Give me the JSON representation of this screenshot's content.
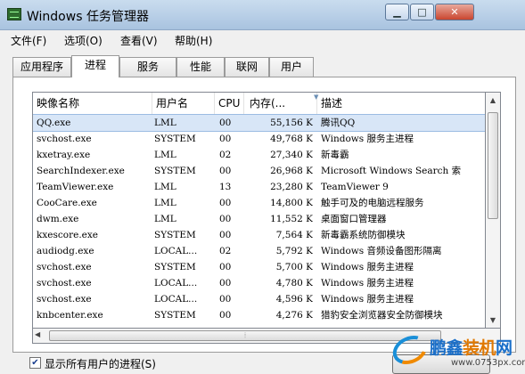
{
  "window": {
    "title": "Windows 任务管理器"
  },
  "menu": [
    "文件(F)",
    "选项(O)",
    "查看(V)",
    "帮助(H)"
  ],
  "tabs": [
    "应用程序",
    "进程",
    "服务",
    "性能",
    "联网",
    "用户"
  ],
  "active_tab": "进程",
  "columns": [
    "映像名称",
    "用户名",
    "CPU",
    "内存(...",
    "描述"
  ],
  "processes": [
    {
      "name": "QQ.exe",
      "user": "LML",
      "cpu": "00",
      "mem": "55,156 K",
      "desc": "腾讯QQ",
      "selected": true
    },
    {
      "name": "svchost.exe",
      "user": "SYSTEM",
      "cpu": "00",
      "mem": "49,768 K",
      "desc": "Windows 服务主进程"
    },
    {
      "name": "kxetray.exe",
      "user": "LML",
      "cpu": "02",
      "mem": "27,340 K",
      "desc": "新毒霸"
    },
    {
      "name": "SearchIndexer.exe",
      "user": "SYSTEM",
      "cpu": "00",
      "mem": "26,968 K",
      "desc": "Microsoft Windows Search 索"
    },
    {
      "name": "TeamViewer.exe",
      "user": "LML",
      "cpu": "13",
      "mem": "23,280 K",
      "desc": "TeamViewer 9"
    },
    {
      "name": "CooCare.exe",
      "user": "LML",
      "cpu": "00",
      "mem": "14,800 K",
      "desc": "触手可及的电脑远程服务"
    },
    {
      "name": "dwm.exe",
      "user": "LML",
      "cpu": "00",
      "mem": "11,552 K",
      "desc": "桌面窗口管理器"
    },
    {
      "name": "kxescore.exe",
      "user": "SYSTEM",
      "cpu": "00",
      "mem": "7,564 K",
      "desc": "新毒霸系统防御模块"
    },
    {
      "name": "audiodg.exe",
      "user": "LOCAL...",
      "cpu": "02",
      "mem": "5,792 K",
      "desc": "Windows 音频设备图形隔离"
    },
    {
      "name": "svchost.exe",
      "user": "SYSTEM",
      "cpu": "00",
      "mem": "5,700 K",
      "desc": "Windows 服务主进程"
    },
    {
      "name": "svchost.exe",
      "user": "LOCAL...",
      "cpu": "00",
      "mem": "4,780 K",
      "desc": "Windows 服务主进程"
    },
    {
      "name": "svchost.exe",
      "user": "LOCAL...",
      "cpu": "00",
      "mem": "4,596 K",
      "desc": "Windows 服务主进程"
    },
    {
      "name": "knbcenter.exe",
      "user": "SYSTEM",
      "cpu": "00",
      "mem": "4,276 K",
      "desc": "猎豹安全浏览器安全防御模块"
    }
  ],
  "show_all_users": {
    "label": "显示所有用户的进程(S)",
    "checked": true
  },
  "watermark": {
    "name_a": "鹏鑫",
    "name_b": "装机",
    "name_c": "网",
    "url": "www.0753px.com"
  },
  "icons": {
    "app": "task-manager-icon",
    "min": "minimize-icon",
    "max": "maximize-icon",
    "close": "close-icon",
    "check": "check-icon"
  }
}
